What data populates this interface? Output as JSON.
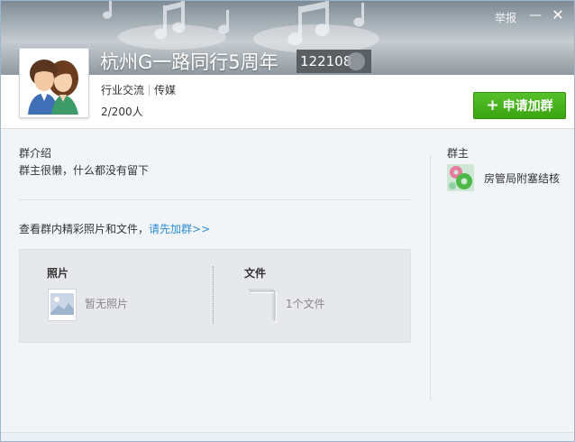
{
  "window": {
    "report_label": "举报",
    "minimize_symbol": "—",
    "close_symbol": "✕"
  },
  "group": {
    "name": "杭州G一路同行5周年",
    "id": "122108",
    "tags": [
      "行业交流",
      "传媒"
    ],
    "members": "2/200人",
    "join_button_label": "申请加群",
    "join_button_icon": "plus-icon",
    "join_button_color": "#3aa510"
  },
  "intro": {
    "title": "群介绍",
    "text": "群主很懒，什么都没有留下"
  },
  "view": {
    "prefix": "查看群内精彩照片和文件，",
    "link": "请先加群>>"
  },
  "panel": {
    "photos_title": "照片",
    "photos_empty": "暂无照片",
    "files_title": "文件",
    "files_count": "1个文件"
  },
  "owner": {
    "title": "群主",
    "name": "房管局附塞结核"
  },
  "colors": {
    "link": "#2d8dd6",
    "accent_green": "#3aa510"
  }
}
